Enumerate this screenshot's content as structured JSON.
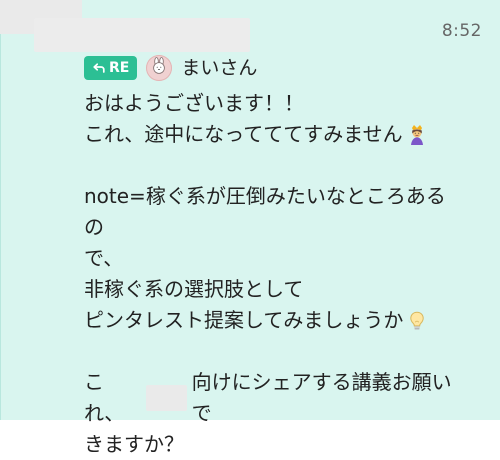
{
  "header": {
    "timestamp": "8:52"
  },
  "reply": {
    "badge_label": "RE",
    "name": "まいさん",
    "icons": {
      "reply": "reply-arrow-icon",
      "avatar": "rabbit-avatar-icon"
    }
  },
  "message": {
    "lines": [
      "おはようございます！！",
      "これ、途中になってててすみません",
      "",
      "note=稼ぐ系が圧倒みたいなところあるの",
      "で、",
      "非稼ぐ系の選択肢として",
      "ピンタレスト提案してみましょうか",
      "",
      "これ、",
      "向けにシェアする講義お願いで",
      "きますか？"
    ]
  },
  "emoji": {
    "line2": "person-with-crown-icon",
    "line7": "lightbulb-icon"
  },
  "colors": {
    "panel_bg": "#d9f5ef",
    "badge_bg": "#2cbf94",
    "timestamp": "#666666",
    "text": "#222222",
    "mask": "#eaeaea"
  }
}
